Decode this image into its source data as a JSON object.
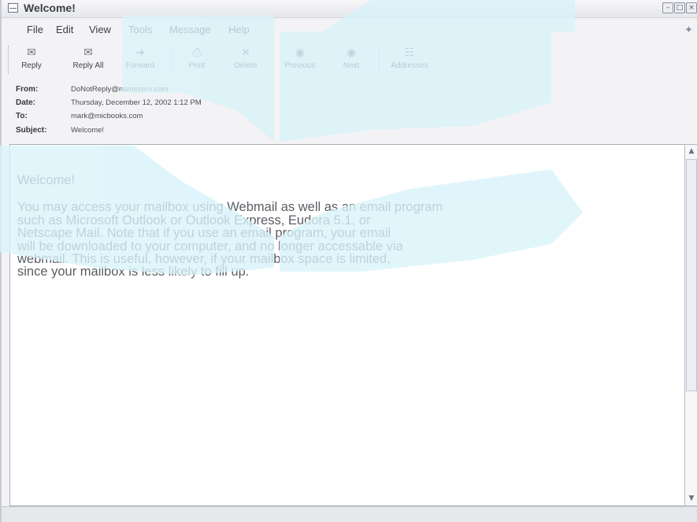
{
  "window": {
    "title": "Welcome!"
  },
  "menu": [
    {
      "label": "File"
    },
    {
      "label": "Edit"
    },
    {
      "label": "View"
    },
    {
      "label": "Tools"
    },
    {
      "label": "Message"
    },
    {
      "label": "Help"
    }
  ],
  "toolbar": {
    "reply": "Reply",
    "reply_all": "Reply All",
    "forward": "Forward",
    "print": "Print",
    "delete": "Delete",
    "previous": "Previous",
    "next": "Next",
    "addresses": "Addresses"
  },
  "header": {
    "from_label": "From:",
    "from_value": "DoNotReply@namezero.com",
    "date_label": "Date:",
    "date_value": "Thursday, December 12, 2002 1:12 PM",
    "to_label": "To:",
    "to_value": "mark@micbooks.com",
    "subject_label": "Subject:",
    "subject_value": "Welcome!"
  },
  "message": {
    "greeting": "Welcome!",
    "line1": "You may access your mailbox using Webmail as well as an email program",
    "line2": "such as Microsoft Outlook or Outlook Express, Eudora 5.1, or",
    "line3": "Netscape Mail.  Note that if you use an email program, your email",
    "line4": "will be downloaded to your computer, and no longer accessable via",
    "line5": "webmail.  This is useful, however, if your mailbox space is limited,",
    "line6": "since your mailbox is less likely to fill up."
  },
  "icons": {
    "reply": "reply-icon",
    "reply_all": "reply-all-icon",
    "forward": "forward-icon",
    "print": "print-icon",
    "delete": "delete-icon",
    "previous": "previous-icon",
    "next": "next-icon",
    "addresses": "address-book-icon"
  },
  "colors": {
    "watermark": "#d8f3fa",
    "body_text": "#5a5d63"
  }
}
